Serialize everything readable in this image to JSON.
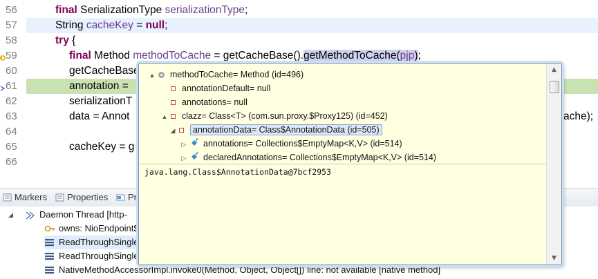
{
  "editor": {
    "lines": [
      {
        "num": "56",
        "segments": [
          {
            "t": "final",
            "c": "kw"
          },
          {
            "t": " SerializationType ",
            "c": ""
          },
          {
            "t": "serializationType",
            "c": "var"
          },
          {
            "t": ";",
            "c": ""
          }
        ]
      },
      {
        "num": "57",
        "segments": [
          {
            "t": "String ",
            "c": ""
          },
          {
            "t": "cacheKey",
            "c": "var"
          },
          {
            "t": " = ",
            "c": ""
          },
          {
            "t": "null",
            "c": "kw"
          },
          {
            "t": ";",
            "c": ""
          }
        ]
      },
      {
        "num": "58",
        "segments": [
          {
            "t": "try",
            "c": "kw"
          },
          {
            "t": " {",
            "c": ""
          }
        ]
      },
      {
        "num": "59",
        "segments": [
          {
            "t": "final",
            "c": "kw"
          },
          {
            "t": " Method ",
            "c": ""
          },
          {
            "t": "methodToCache",
            "c": "var"
          },
          {
            "t": " = getCacheBase().",
            "c": ""
          },
          {
            "t": "getMethodToCache(",
            "c": "sel"
          },
          {
            "t": "pjp",
            "c": "sel var"
          },
          {
            "t": ")",
            "c": "sel"
          },
          {
            "t": ";",
            "c": ""
          }
        ]
      },
      {
        "num": "60",
        "segments": [
          {
            "t": "getCacheBase",
            "c": ""
          }
        ]
      },
      {
        "num": "61",
        "segments": [
          {
            "t": "annotation = ",
            "c": ""
          }
        ]
      },
      {
        "num": "62",
        "segments": [
          {
            "t": "serializationT",
            "c": ""
          }
        ]
      },
      {
        "num": "63",
        "segments": [
          {
            "t": "data = Annot",
            "c": ""
          }
        ]
      },
      {
        "num": "64",
        "segments": []
      },
      {
        "num": "65",
        "segments": [
          {
            "t": "cacheKey = g",
            "c": ""
          }
        ]
      },
      {
        "num": "66",
        "segments": []
      }
    ],
    "line63_tail": "ache);"
  },
  "views": {
    "tabs": [
      {
        "label": "Markers",
        "icon": "markers-icon"
      },
      {
        "label": "Properties",
        "icon": "properties-icon"
      },
      {
        "label": "Pr",
        "icon": "progress-icon"
      }
    ]
  },
  "debug_tree": {
    "rows": [
      {
        "label": "Daemon Thread [http-",
        "icon": "thread-icon"
      },
      {
        "label": "owns: NioEndpoint$",
        "icon": "key-icon"
      },
      {
        "label": "ReadThroughSingle",
        "icon": "stack-frame-icon"
      },
      {
        "label": "ReadThroughSingle",
        "icon": "stack-frame-icon"
      },
      {
        "label": "NativeMethodAccessorImpl.invoke0(Method, Object, Object[]) line: not available [native method]",
        "icon": "stack-frame-icon"
      }
    ]
  },
  "popup": {
    "rows": [
      {
        "label": "methodToCache= Method  (id=496)",
        "twist": "▲",
        "icon": "object-icon"
      },
      {
        "label": "annotationDefault= null",
        "twist": "",
        "icon": "field-icon"
      },
      {
        "label": "annotations= null",
        "twist": "",
        "icon": "field-icon"
      },
      {
        "label": "clazz= Class<T> (com.sun.proxy.$Proxy125) (id=452)",
        "twist": "▲",
        "icon": "field-icon"
      },
      {
        "label": "annotationData= Class$AnnotationData  (id=505)",
        "twist": "◢",
        "icon": "field-icon"
      },
      {
        "label": "annotations= Collections$EmptyMap<K,V>  (id=514)",
        "twist": "▷",
        "icon": "final-field-icon"
      },
      {
        "label": "declaredAnnotations= Collections$EmptyMap<K,V>  (id=514)",
        "twist": "▷",
        "icon": "final-field-icon"
      }
    ],
    "detail": "java.lang.Class$AnnotationData@7bcf2953"
  }
}
